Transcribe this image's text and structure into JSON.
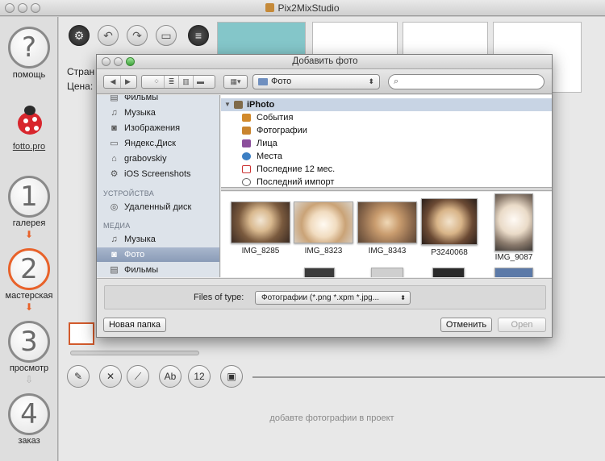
{
  "app": {
    "title": "Pix2MixStudio"
  },
  "sidebar": {
    "help_label": "помощь",
    "help_glyph": "?",
    "logo_link": "fotto.pro",
    "steps": [
      {
        "number": "1",
        "label": "галерея"
      },
      {
        "number": "2",
        "label": "мастерская"
      },
      {
        "number": "3",
        "label": "просмотр"
      },
      {
        "number": "4",
        "label": "заказ"
      }
    ],
    "accent_color": "#e8622a"
  },
  "main": {
    "page_label_partial": "Стран",
    "price_label_partial": "Цена:",
    "empty_hint": "добавте фотографии в проект"
  },
  "dialog": {
    "title": "Добавить фото",
    "path_popup": "Фото",
    "search_placeholder": "",
    "sidebar": {
      "items_top": [
        {
          "label": "Фильмы",
          "icon": "film-icon"
        },
        {
          "label": "Музыка",
          "icon": "music-icon"
        },
        {
          "label": "Изображения",
          "icon": "camera-icon"
        },
        {
          "label": "Яндекс.Диск",
          "icon": "folder-icon"
        },
        {
          "label": "grabovskiy",
          "icon": "home-icon"
        },
        {
          "label": "iOS Screenshots",
          "icon": "gear-icon"
        }
      ],
      "devices_header": "УСТРОЙСТВА",
      "devices": [
        {
          "label": "Удаленный диск",
          "icon": "disc-icon"
        }
      ],
      "media_header": "МЕДИА",
      "media": [
        {
          "label": "Музыка",
          "icon": "music-icon"
        },
        {
          "label": "Фото",
          "icon": "camera-icon"
        },
        {
          "label": "Фильмы",
          "icon": "film-icon"
        }
      ]
    },
    "tree": [
      {
        "label": "iPhoto",
        "selected": true
      },
      {
        "label": "События"
      },
      {
        "label": "Фотографии"
      },
      {
        "label": "Лица"
      },
      {
        "label": "Места"
      },
      {
        "label": "Последние 12 мес."
      },
      {
        "label": "Последний импорт"
      }
    ],
    "photos": [
      {
        "name": "IMG_8285"
      },
      {
        "name": "IMG_8323"
      },
      {
        "name": "IMG_8343"
      },
      {
        "name": "P3240068"
      },
      {
        "name": "IMG_9087"
      }
    ],
    "filter_label": "Files of type:",
    "filter_value": "Фотографии (*.png *.xpm *.jpg...",
    "new_folder_button": "Новая папка",
    "cancel_button": "Отменить",
    "open_button": "Open"
  }
}
